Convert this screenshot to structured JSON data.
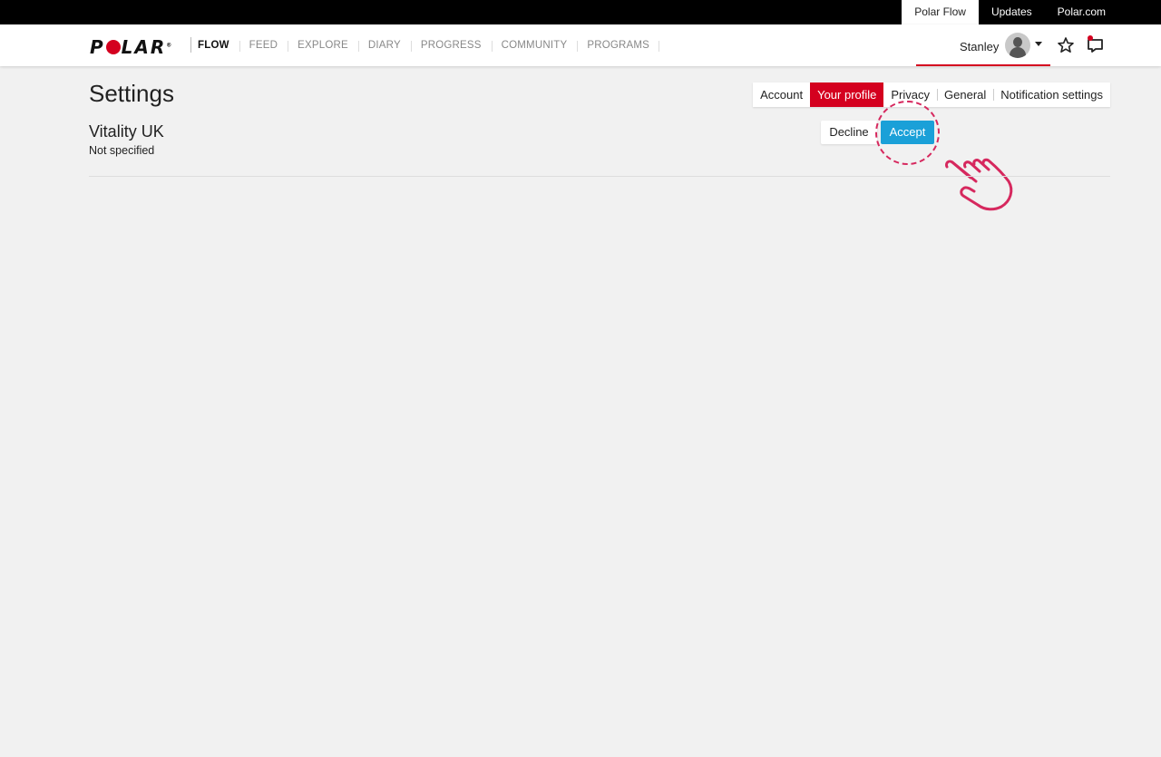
{
  "topbar": {
    "links": [
      {
        "label": "Polar Flow",
        "active": true
      },
      {
        "label": "Updates",
        "active": false
      },
      {
        "label": "Polar.com",
        "active": false
      }
    ]
  },
  "navbar": {
    "logo_text": "P L A R",
    "nav_items": [
      "FLOW",
      "FEED",
      "EXPLORE",
      "DIARY",
      "PROGRESS",
      "COMMUNITY",
      "PROGRAMS"
    ],
    "username": "Stanley",
    "icons": [
      "star-icon",
      "message-icon"
    ]
  },
  "page": {
    "title": "Settings",
    "tabs": [
      {
        "label": "Account",
        "active": false
      },
      {
        "label": "Your profile",
        "active": true
      },
      {
        "label": "Privacy",
        "active": false
      },
      {
        "label": "General",
        "active": false
      },
      {
        "label": "Notification settings",
        "active": false
      }
    ]
  },
  "section": {
    "title": "Vitality UK",
    "subtitle": "Not specified",
    "decline_label": "Decline",
    "accept_label": "Accept"
  },
  "colors": {
    "brand_red": "#d4001f",
    "accept_blue": "#1aa0d8",
    "highlight_pink": "#d6285e"
  }
}
